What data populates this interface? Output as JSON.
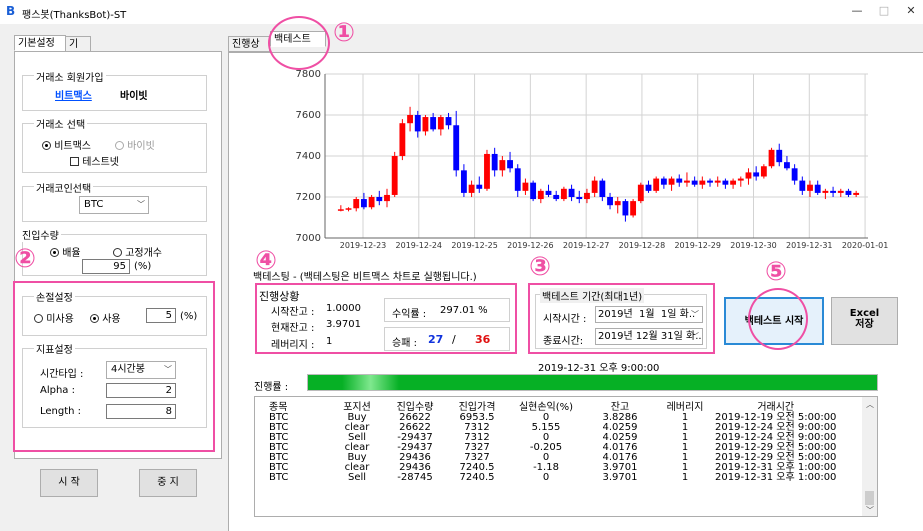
{
  "window": {
    "title": "팽스봇(ThanksBot)-ST",
    "icon_letter": "B"
  },
  "left_tabs": [
    "기본설정",
    "기타"
  ],
  "exchange_signup": {
    "title": "거래소 회원가입",
    "links": [
      "비트맥스",
      "바이빗"
    ]
  },
  "exchange_select": {
    "title": "거래소 선택",
    "options": [
      "비트맥스",
      "바이빗"
    ],
    "selected": "비트맥스",
    "testnet_label": "테스트넷"
  },
  "coin_select": {
    "title": "거래코인선택",
    "value": "BTC"
  },
  "entry_qty": {
    "title": "진입수량",
    "options": [
      "배율",
      "고정개수"
    ],
    "selected": "배율",
    "value": "95",
    "unit": "(%)"
  },
  "stoploss": {
    "title": "손절설정",
    "options": [
      "미사용",
      "사용"
    ],
    "selected": "사용",
    "value": "5",
    "unit": "(%)"
  },
  "indicator": {
    "title": "지표설정",
    "time_type_label": "시간타입 :",
    "time_type_value": "4시간봉",
    "alpha_label": "Alpha :",
    "alpha_value": "2",
    "length_label": "Length :",
    "length_value": "8"
  },
  "buttons": {
    "start": "시 작",
    "stop": "중 지",
    "backtest_start": "백테스트 시작",
    "excel_save_1": "Excel",
    "excel_save_2": "저장"
  },
  "right_tabs": [
    "진행상황",
    "백테스트"
  ],
  "markers": [
    "①",
    "②",
    "③",
    "④",
    "⑤"
  ],
  "chart_data": {
    "type": "candlestick",
    "x_ticks": [
      "2019-12-23",
      "2019-12-24",
      "2019-12-25",
      "2019-12-26",
      "2019-12-27",
      "2019-12-28",
      "2019-12-29",
      "2019-12-30",
      "2019-12-31",
      "2020-01-01"
    ],
    "y_ticks": [
      7000,
      7200,
      7400,
      7600,
      7800
    ],
    "ylim": [
      7000,
      7800
    ],
    "up_color": "#ff0000",
    "down_color": "#0000ff",
    "candles_ohlc": [
      [
        7140,
        7160,
        7130,
        7140
      ],
      [
        7140,
        7150,
        7130,
        7145
      ],
      [
        7145,
        7200,
        7130,
        7190
      ],
      [
        7190,
        7220,
        7140,
        7150
      ],
      [
        7150,
        7210,
        7140,
        7200
      ],
      [
        7200,
        7230,
        7160,
        7180
      ],
      [
        7180,
        7240,
        7150,
        7210
      ],
      [
        7210,
        7420,
        7200,
        7400
      ],
      [
        7400,
        7580,
        7380,
        7560
      ],
      [
        7560,
        7640,
        7520,
        7600
      ],
      [
        7600,
        7620,
        7490,
        7520
      ],
      [
        7520,
        7600,
        7500,
        7590
      ],
      [
        7590,
        7610,
        7520,
        7530
      ],
      [
        7530,
        7600,
        7500,
        7590
      ],
      [
        7590,
        7610,
        7530,
        7550
      ],
      [
        7550,
        7620,
        7300,
        7330
      ],
      [
        7330,
        7360,
        7200,
        7220
      ],
      [
        7220,
        7280,
        7200,
        7260
      ],
      [
        7260,
        7300,
        7220,
        7240
      ],
      [
        7240,
        7430,
        7230,
        7410
      ],
      [
        7410,
        7440,
        7300,
        7330
      ],
      [
        7330,
        7400,
        7300,
        7380
      ],
      [
        7380,
        7420,
        7320,
        7340
      ],
      [
        7340,
        7360,
        7200,
        7230
      ],
      [
        7230,
        7290,
        7210,
        7270
      ],
      [
        7270,
        7280,
        7180,
        7190
      ],
      [
        7190,
        7240,
        7170,
        7230
      ],
      [
        7230,
        7260,
        7200,
        7210
      ],
      [
        7210,
        7230,
        7180,
        7190
      ],
      [
        7190,
        7250,
        7180,
        7240
      ],
      [
        7240,
        7260,
        7180,
        7200
      ],
      [
        7200,
        7230,
        7170,
        7190
      ],
      [
        7190,
        7240,
        7170,
        7220
      ],
      [
        7220,
        7300,
        7200,
        7280
      ],
      [
        7280,
        7290,
        7180,
        7200
      ],
      [
        7200,
        7220,
        7140,
        7160
      ],
      [
        7160,
        7200,
        7120,
        7180
      ],
      [
        7180,
        7190,
        7080,
        7110
      ],
      [
        7110,
        7190,
        7100,
        7180
      ],
      [
        7180,
        7270,
        7170,
        7260
      ],
      [
        7260,
        7280,
        7220,
        7230
      ],
      [
        7230,
        7300,
        7220,
        7290
      ],
      [
        7290,
        7300,
        7240,
        7260
      ],
      [
        7260,
        7300,
        7230,
        7290
      ],
      [
        7290,
        7310,
        7250,
        7270
      ],
      [
        7270,
        7320,
        7250,
        7280
      ],
      [
        7280,
        7300,
        7250,
        7260
      ],
      [
        7260,
        7300,
        7240,
        7280
      ],
      [
        7280,
        7290,
        7250,
        7270
      ],
      [
        7270,
        7300,
        7250,
        7280
      ],
      [
        7280,
        7290,
        7240,
        7260
      ],
      [
        7260,
        7290,
        7240,
        7280
      ],
      [
        7280,
        7300,
        7250,
        7290
      ],
      [
        7290,
        7340,
        7260,
        7320
      ],
      [
        7320,
        7350,
        7280,
        7300
      ],
      [
        7300,
        7360,
        7290,
        7350
      ],
      [
        7350,
        7440,
        7340,
        7430
      ],
      [
        7430,
        7460,
        7350,
        7370
      ],
      [
        7370,
        7400,
        7330,
        7340
      ],
      [
        7340,
        7360,
        7260,
        7280
      ],
      [
        7280,
        7300,
        7210,
        7230
      ],
      [
        7230,
        7280,
        7200,
        7260
      ],
      [
        7260,
        7280,
        7210,
        7220
      ],
      [
        7220,
        7240,
        7190,
        7230
      ],
      [
        7230,
        7250,
        7200,
        7220
      ],
      [
        7220,
        7240,
        7200,
        7230
      ],
      [
        7230,
        7240,
        7200,
        7210
      ],
      [
        7210,
        7230,
        7200,
        7220
      ]
    ]
  },
  "backtest_note": "백테스팅 - (백테스팅은 비트맥스 차트로 실행됩니다.)",
  "progress_box": {
    "title": "진행상황",
    "start_balance_label": "시작잔고 :",
    "start_balance": "1.0000",
    "current_balance_label": "현재잔고 :",
    "current_balance": "3.9701",
    "leverage_label": "레버리지 :",
    "leverage": "1",
    "return_label": "수익률 :",
    "return_value": "297.01 %",
    "winloss_label": "승패 :",
    "wins": "27",
    "slash": "/",
    "losses": "36"
  },
  "period_box": {
    "title": "백테스트 기간(최대1년)",
    "start_label": "시작시간 :",
    "start_value": "2019년  1월  1일 화..",
    "end_label": "종료시간:",
    "end_value": "2019년 12월 31일 화.."
  },
  "current_time": "2019-12-31 오후 9:00:00",
  "progress_label": "진행률 :",
  "progress_fraction": 1.0,
  "trade_log": {
    "headers": [
      "종목",
      "포지션",
      "진입수량",
      "진입가격",
      "실현손익(%)",
      "잔고",
      "레버리지",
      "거래시간"
    ],
    "rows": [
      [
        "BTC",
        "Buy",
        "26622",
        "6953.5",
        "0",
        "3.8286",
        "1",
        "2019-12-19 오전 5:00:00"
      ],
      [
        "BTC",
        "clear",
        "26622",
        "7312",
        "5.155",
        "4.0259",
        "1",
        "2019-12-24 오전 9:00:00"
      ],
      [
        "BTC",
        "Sell",
        "-29437",
        "7312",
        "0",
        "4.0259",
        "1",
        "2019-12-24 오전 9:00:00"
      ],
      [
        "BTC",
        "clear",
        "-29437",
        "7327",
        "-0.205",
        "4.0176",
        "1",
        "2019-12-29 오전 5:00:00"
      ],
      [
        "BTC",
        "Buy",
        "29436",
        "7327",
        "0",
        "4.0176",
        "1",
        "2019-12-29 오전 5:00:00"
      ],
      [
        "BTC",
        "clear",
        "29436",
        "7240.5",
        "-1.18",
        "3.9701",
        "1",
        "2019-12-31 오후 1:00:00"
      ],
      [
        "BTC",
        "Sell",
        "-28745",
        "7240.5",
        "0",
        "3.9701",
        "1",
        "2019-12-31 오후 1:00:00"
      ]
    ]
  }
}
